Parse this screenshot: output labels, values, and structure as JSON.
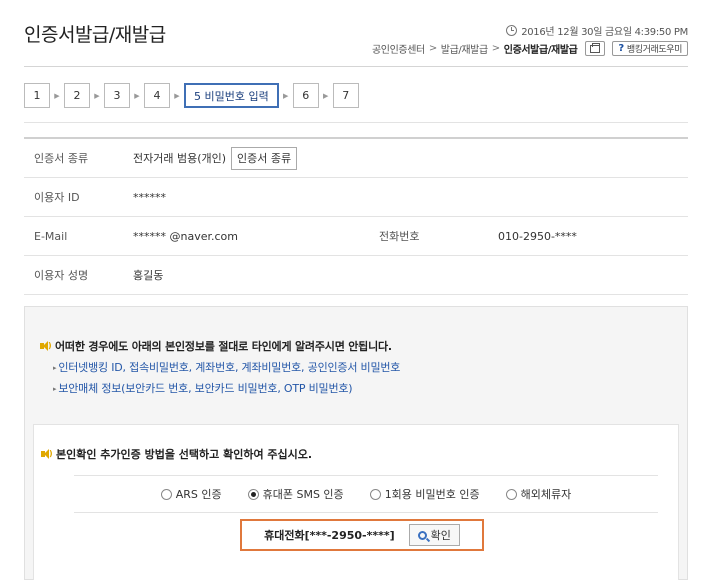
{
  "header": {
    "title": "인증서발급/재발급",
    "datetime": "2016년 12월 30일 금요일 4:39:50 PM",
    "help_label": "뱅킹거래도우미",
    "help_q": "?"
  },
  "breadcrumb": {
    "items": [
      "공인인증센터",
      "발급/재발급"
    ],
    "separator": ">",
    "current": "인증서발급/재발급"
  },
  "steps": [
    "1",
    "2",
    "3",
    "4",
    "5 비밀번호 입력",
    "6",
    "7"
  ],
  "info": {
    "cert_type_label": "인증서 종류",
    "cert_type_value": "전자거래 범용(개인)",
    "cert_type_button": "인증서 종류",
    "user_id_label": "이용자 ID",
    "user_id_value": "******",
    "email_label": "E-Mail",
    "email_value": "****** @naver.com",
    "phone_label": "전화번호",
    "phone_value": "010-2950-****",
    "name_label": "이용자 성명",
    "name_value": "홍길동"
  },
  "warning": {
    "title": "어떠한 경우에도 아래의 본인정보를 절대로 타인에게 알려주시면 안됩니다.",
    "items": [
      "인터넷뱅킹 ID, 접속비밀번호, 계좌번호, 계좌비밀번호, 공인인증서 비밀번호",
      "보안매체 정보(보안카드 번호, 보안카드 비밀번호, OTP 비밀번호)"
    ]
  },
  "verify": {
    "title": "본인확인 추가인증 방법을 선택하고 확인하여 주십시오.",
    "options": [
      "ARS 인증",
      "휴대폰 SMS 인증",
      "1회용 비밀번호 인증",
      "해외체류자"
    ],
    "selected": "휴대폰 SMS 인증",
    "phone_label": "휴대전화[***-2950-****]",
    "confirm_button": "확인"
  },
  "colors": {
    "active_step_border": "#3f6fb5",
    "highlight_border": "#e0783c",
    "link_blue": "#2457a8",
    "speaker_yellow": "#e0a800"
  }
}
